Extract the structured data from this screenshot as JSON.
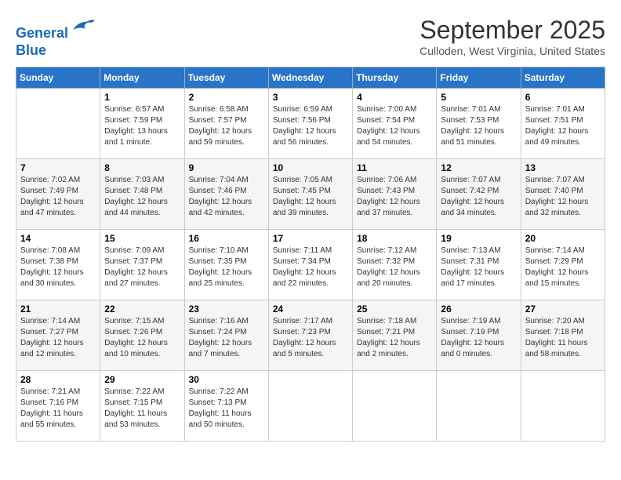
{
  "logo": {
    "line1": "General",
    "line2": "Blue"
  },
  "title": "September 2025",
  "subtitle": "Culloden, West Virginia, United States",
  "days_header": [
    "Sunday",
    "Monday",
    "Tuesday",
    "Wednesday",
    "Thursday",
    "Friday",
    "Saturday"
  ],
  "weeks": [
    [
      {
        "day": "",
        "info": ""
      },
      {
        "day": "1",
        "info": "Sunrise: 6:57 AM\nSunset: 7:59 PM\nDaylight: 13 hours\nand 1 minute."
      },
      {
        "day": "2",
        "info": "Sunrise: 6:58 AM\nSunset: 7:57 PM\nDaylight: 12 hours\nand 59 minutes."
      },
      {
        "day": "3",
        "info": "Sunrise: 6:59 AM\nSunset: 7:56 PM\nDaylight: 12 hours\nand 56 minutes."
      },
      {
        "day": "4",
        "info": "Sunrise: 7:00 AM\nSunset: 7:54 PM\nDaylight: 12 hours\nand 54 minutes."
      },
      {
        "day": "5",
        "info": "Sunrise: 7:01 AM\nSunset: 7:53 PM\nDaylight: 12 hours\nand 51 minutes."
      },
      {
        "day": "6",
        "info": "Sunrise: 7:01 AM\nSunset: 7:51 PM\nDaylight: 12 hours\nand 49 minutes."
      }
    ],
    [
      {
        "day": "7",
        "info": "Sunrise: 7:02 AM\nSunset: 7:49 PM\nDaylight: 12 hours\nand 47 minutes."
      },
      {
        "day": "8",
        "info": "Sunrise: 7:03 AM\nSunset: 7:48 PM\nDaylight: 12 hours\nand 44 minutes."
      },
      {
        "day": "9",
        "info": "Sunrise: 7:04 AM\nSunset: 7:46 PM\nDaylight: 12 hours\nand 42 minutes."
      },
      {
        "day": "10",
        "info": "Sunrise: 7:05 AM\nSunset: 7:45 PM\nDaylight: 12 hours\nand 39 minutes."
      },
      {
        "day": "11",
        "info": "Sunrise: 7:06 AM\nSunset: 7:43 PM\nDaylight: 12 hours\nand 37 minutes."
      },
      {
        "day": "12",
        "info": "Sunrise: 7:07 AM\nSunset: 7:42 PM\nDaylight: 12 hours\nand 34 minutes."
      },
      {
        "day": "13",
        "info": "Sunrise: 7:07 AM\nSunset: 7:40 PM\nDaylight: 12 hours\nand 32 minutes."
      }
    ],
    [
      {
        "day": "14",
        "info": "Sunrise: 7:08 AM\nSunset: 7:38 PM\nDaylight: 12 hours\nand 30 minutes."
      },
      {
        "day": "15",
        "info": "Sunrise: 7:09 AM\nSunset: 7:37 PM\nDaylight: 12 hours\nand 27 minutes."
      },
      {
        "day": "16",
        "info": "Sunrise: 7:10 AM\nSunset: 7:35 PM\nDaylight: 12 hours\nand 25 minutes."
      },
      {
        "day": "17",
        "info": "Sunrise: 7:11 AM\nSunset: 7:34 PM\nDaylight: 12 hours\nand 22 minutes."
      },
      {
        "day": "18",
        "info": "Sunrise: 7:12 AM\nSunset: 7:32 PM\nDaylight: 12 hours\nand 20 minutes."
      },
      {
        "day": "19",
        "info": "Sunrise: 7:13 AM\nSunset: 7:31 PM\nDaylight: 12 hours\nand 17 minutes."
      },
      {
        "day": "20",
        "info": "Sunrise: 7:14 AM\nSunset: 7:29 PM\nDaylight: 12 hours\nand 15 minutes."
      }
    ],
    [
      {
        "day": "21",
        "info": "Sunrise: 7:14 AM\nSunset: 7:27 PM\nDaylight: 12 hours\nand 12 minutes."
      },
      {
        "day": "22",
        "info": "Sunrise: 7:15 AM\nSunset: 7:26 PM\nDaylight: 12 hours\nand 10 minutes."
      },
      {
        "day": "23",
        "info": "Sunrise: 7:16 AM\nSunset: 7:24 PM\nDaylight: 12 hours\nand 7 minutes."
      },
      {
        "day": "24",
        "info": "Sunrise: 7:17 AM\nSunset: 7:23 PM\nDaylight: 12 hours\nand 5 minutes."
      },
      {
        "day": "25",
        "info": "Sunrise: 7:18 AM\nSunset: 7:21 PM\nDaylight: 12 hours\nand 2 minutes."
      },
      {
        "day": "26",
        "info": "Sunrise: 7:19 AM\nSunset: 7:19 PM\nDaylight: 12 hours\nand 0 minutes."
      },
      {
        "day": "27",
        "info": "Sunrise: 7:20 AM\nSunset: 7:18 PM\nDaylight: 11 hours\nand 58 minutes."
      }
    ],
    [
      {
        "day": "28",
        "info": "Sunrise: 7:21 AM\nSunset: 7:16 PM\nDaylight: 11 hours\nand 55 minutes."
      },
      {
        "day": "29",
        "info": "Sunrise: 7:22 AM\nSunset: 7:15 PM\nDaylight: 11 hours\nand 53 minutes."
      },
      {
        "day": "30",
        "info": "Sunrise: 7:22 AM\nSunset: 7:13 PM\nDaylight: 11 hours\nand 50 minutes."
      },
      {
        "day": "",
        "info": ""
      },
      {
        "day": "",
        "info": ""
      },
      {
        "day": "",
        "info": ""
      },
      {
        "day": "",
        "info": ""
      }
    ]
  ]
}
